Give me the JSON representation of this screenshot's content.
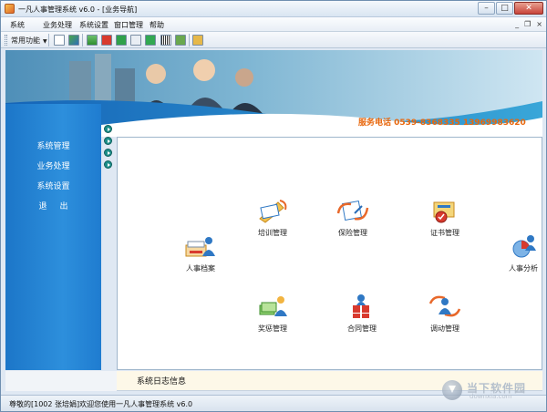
{
  "window": {
    "title": "一凡人事管理系统 v6.0 - [业务导航]",
    "controls": {
      "minimize": "–",
      "maximize": "□",
      "close": "✕"
    }
  },
  "menubar": {
    "items": [
      "系统",
      "业务处理",
      "系统设置",
      "窗口管理",
      "帮助"
    ],
    "mdi_controls": [
      "_",
      "❐",
      "×"
    ]
  },
  "toolbar": {
    "dropdown_label": "常用功能",
    "icons": [
      "document-icon",
      "transfer-icon",
      "grid-icon",
      "pdf-icon",
      "green-e-icon",
      "card-icon",
      "green-c-icon",
      "barcode-icon",
      "book-icon",
      "exit-icon"
    ]
  },
  "banner": {
    "phone_text": "服务电话  0539-8368335  13969983620"
  },
  "left_nav": {
    "items": [
      "系统管理",
      "业务处理",
      "系统设置",
      "退出"
    ]
  },
  "modules": [
    {
      "label": "培训管理",
      "icon": "training-icon"
    },
    {
      "label": "保险管理",
      "icon": "insurance-icon"
    },
    {
      "label": "证书管理",
      "icon": "certificate-icon"
    },
    {
      "label": "人事档案",
      "icon": "personnel-file-icon"
    },
    {
      "label": "人事分析",
      "icon": "analysis-icon"
    },
    {
      "label": "奖惩管理",
      "icon": "reward-punish-icon"
    },
    {
      "label": "合同管理",
      "icon": "contract-icon"
    },
    {
      "label": "调动管理",
      "icon": "transfer-management-icon"
    }
  ],
  "log_section": {
    "label": "系统日志信息"
  },
  "statusbar": {
    "text": "尊敬的[1002 张培娟]欢迎您使用一凡人事管理系统 v6.0"
  },
  "watermark": {
    "main": "当下软件园",
    "sub": "downxia.com"
  },
  "colors": {
    "nav_blue": "#2d8fdc",
    "phone_orange": "#e8670d",
    "accent_teal": "#1d8f8a"
  }
}
